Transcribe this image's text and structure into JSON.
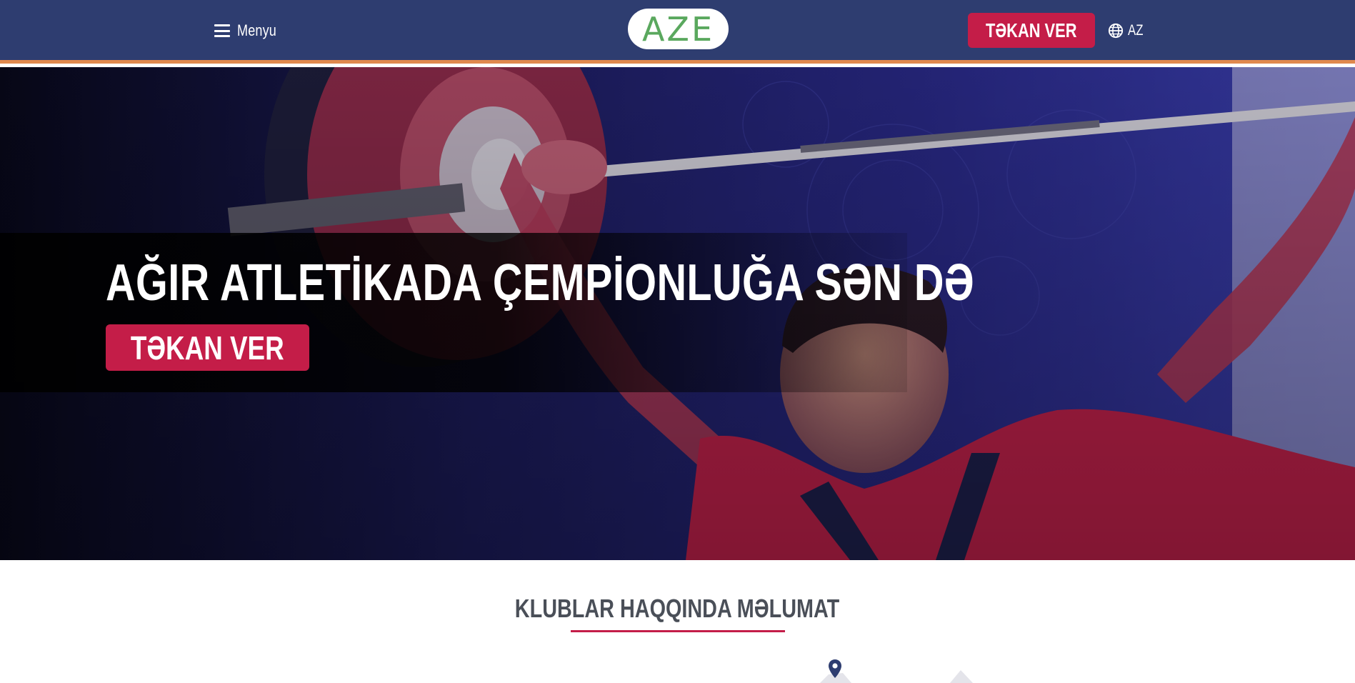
{
  "header": {
    "menu_label": "Menyu",
    "logo_text": "AZE",
    "donate_label": "TƏKAN VER",
    "language": "AZ"
  },
  "hero": {
    "title": "AĞIR ATLETİKADA ÇEMPİONLUĞA SƏN DƏ",
    "button_label": "TƏKAN VER"
  },
  "clubs": {
    "title": "KLUBLAR HAQQINDA MƏLUMAT"
  },
  "icons": {
    "menu": "hamburger-icon",
    "language": "globe-icon",
    "map": "map-pin-icon"
  },
  "colors": {
    "header_bg": "#2e3d70",
    "header_accent": "#e0894e",
    "primary_button": "#c41d48",
    "logo_text": "#5aa85e",
    "section_title": "#4a4f58"
  }
}
